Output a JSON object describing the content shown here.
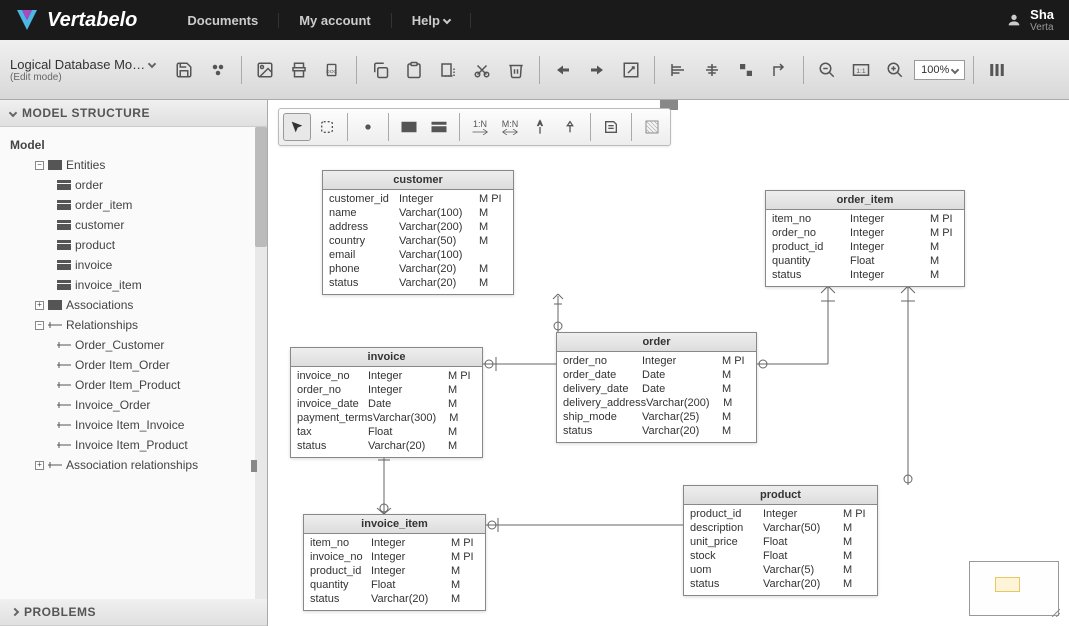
{
  "header": {
    "brand": "Vertabelo",
    "nav": {
      "documents": "Documents",
      "account": "My account",
      "help": "Help"
    },
    "user": {
      "name": "Sha",
      "sub": "Verta"
    }
  },
  "doc": {
    "title": "Logical Database Mo…",
    "mode": "(Edit mode)"
  },
  "zoom": "100%",
  "sections": {
    "model_structure": "MODEL STRUCTURE",
    "problems": "PROBLEMS"
  },
  "tree": {
    "root": "Model",
    "entities_label": "Entities",
    "entities": [
      "order",
      "order_item",
      "customer",
      "product",
      "invoice",
      "invoice_item"
    ],
    "associations_label": "Associations",
    "relationships_label": "Relationships",
    "relationships": [
      "Order_Customer",
      "Order Item_Order",
      "Order Item_Product",
      "Invoice_Order",
      "Invoice Item_Invoice",
      "Invoice Item_Product"
    ],
    "assoc_rel_label": "Association relationships"
  },
  "entities": {
    "customer": {
      "name": "customer",
      "cols": [
        [
          "customer_id",
          "Integer",
          "M PI"
        ],
        [
          "name",
          "Varchar(100)",
          "M"
        ],
        [
          "address",
          "Varchar(200)",
          "M"
        ],
        [
          "country",
          "Varchar(50)",
          "M"
        ],
        [
          "email",
          "Varchar(100)",
          ""
        ],
        [
          "phone",
          "Varchar(20)",
          "M"
        ],
        [
          "status",
          "Varchar(20)",
          "M"
        ]
      ]
    },
    "order_item": {
      "name": "order_item",
      "cols": [
        [
          "item_no",
          "Integer",
          "M PI"
        ],
        [
          "order_no",
          "Integer",
          "M PI"
        ],
        [
          "product_id",
          "Integer",
          "M"
        ],
        [
          "quantity",
          "Float",
          "M"
        ],
        [
          "status",
          "Integer",
          "M"
        ]
      ]
    },
    "invoice": {
      "name": "invoice",
      "cols": [
        [
          "invoice_no",
          "Integer",
          "M PI"
        ],
        [
          "order_no",
          "Integer",
          "M"
        ],
        [
          "invoice_date",
          "Date",
          "M"
        ],
        [
          "payment_terms",
          "Varchar(300)",
          "M"
        ],
        [
          "tax",
          "Float",
          "M"
        ],
        [
          "status",
          "Varchar(20)",
          "M"
        ]
      ]
    },
    "order": {
      "name": "order",
      "cols": [
        [
          "order_no",
          "Integer",
          "M PI"
        ],
        [
          "order_date",
          "Date",
          "M"
        ],
        [
          "delivery_date",
          "Date",
          "M"
        ],
        [
          "delivery_address",
          "Varchar(200)",
          "M"
        ],
        [
          "ship_mode",
          "Varchar(25)",
          "M"
        ],
        [
          "status",
          "Varchar(20)",
          "M"
        ]
      ]
    },
    "product": {
      "name": "product",
      "cols": [
        [
          "product_id",
          "Integer",
          "M PI"
        ],
        [
          "description",
          "Varchar(50)",
          "M"
        ],
        [
          "unit_price",
          "Float",
          "M"
        ],
        [
          "stock",
          "Float",
          "M"
        ],
        [
          "uom",
          "Varchar(5)",
          "M"
        ],
        [
          "status",
          "Varchar(20)",
          "M"
        ]
      ]
    },
    "invoice_item": {
      "name": "invoice_item",
      "cols": [
        [
          "item_no",
          "Integer",
          "M PI"
        ],
        [
          "invoice_no",
          "Integer",
          "M PI"
        ],
        [
          "product_id",
          "Integer",
          "M"
        ],
        [
          "quantity",
          "Float",
          "M"
        ],
        [
          "status",
          "Varchar(20)",
          "M"
        ]
      ]
    }
  },
  "canvas_tool_labels": {
    "one_n": "1:N",
    "m_n": "M:N"
  }
}
